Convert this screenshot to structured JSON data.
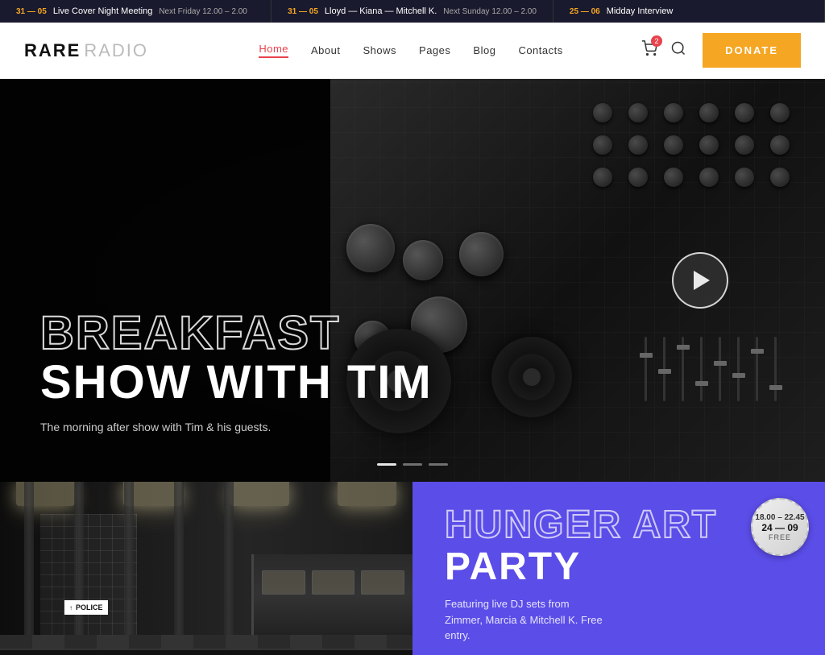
{
  "ticker": {
    "items": [
      {
        "date": "31 — 05",
        "title": "Live Cover Night Meeting",
        "time": "Next Friday 12.00 – 2.00"
      },
      {
        "date": "31 — 05",
        "title": "Lloyd — Kiana — Mitchell K.",
        "time": "Next Sunday 12.00 – 2.00"
      },
      {
        "date": "25 — 06",
        "title": "Midday Interview",
        "time": ""
      }
    ]
  },
  "logo": {
    "rare": "RARE",
    "radio": "RADIO"
  },
  "nav": {
    "items": [
      {
        "label": "Home",
        "active": true
      },
      {
        "label": "About",
        "active": false
      },
      {
        "label": "Shows",
        "active": false
      },
      {
        "label": "Pages",
        "active": false
      },
      {
        "label": "Blog",
        "active": false
      },
      {
        "label": "Contacts",
        "active": false
      }
    ],
    "cart_count": "2",
    "donate_label": "DONATE"
  },
  "hero": {
    "title_outline": "BREAKFAST",
    "title_solid_1": "SHOW",
    "title_solid_2": "WITH TIM",
    "subtitle": "The morning after show with Tim & his guests.",
    "dots": [
      {
        "active": true
      },
      {
        "active": false
      },
      {
        "active": false
      }
    ]
  },
  "event": {
    "badge_time": "18.00 – 22.45",
    "badge_date": "24 — 09",
    "badge_free": "FREE",
    "title_outline": "HUNGER ART",
    "title_solid": "PARTY",
    "description": "Featuring live DJ sets from Zimmer, Marcia & Mitchell K. Free entry."
  }
}
